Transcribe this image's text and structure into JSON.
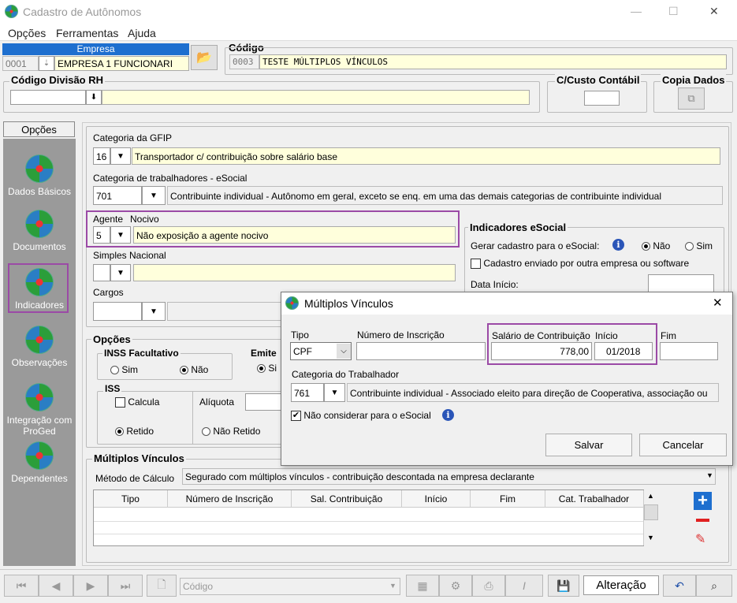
{
  "window": {
    "title": "Cadastro de Autônomos",
    "min": "—",
    "max": "☐",
    "close": "✕"
  },
  "menu": [
    "Opções",
    "Ferramentas",
    "Ajuda"
  ],
  "empresa": {
    "label": "Empresa",
    "code": "0001",
    "name": "EMPRESA 1 FUNCIONARI"
  },
  "codigo": {
    "label": "Código",
    "code": "0003",
    "name": "TESTE MÚLTIPLOS VÍNCULOS"
  },
  "divisao": {
    "label": "Código Divisão RH",
    "value": ""
  },
  "custo": {
    "label": "C/Custo Contábil"
  },
  "copia": {
    "label": "Copia Dados"
  },
  "sidebar": {
    "header": "Opções",
    "items": [
      "Dados Básicos",
      "Documentos",
      "Indicadores",
      "Observações",
      "Integração com ProGed",
      "Dependentes"
    ]
  },
  "gfip": {
    "label": "Categoria da GFIP",
    "code": "16",
    "desc": "Transportador c/ contribuição sobre salário base"
  },
  "esocial_cat": {
    "label": "Categoria de trabalhadores - eSocial",
    "code": "701",
    "desc": "Contribuinte individual - Autônomo em geral, exceto se enq. em uma das demais categorias de contribuinte individual"
  },
  "agente": {
    "label": "Agente",
    "label2": "Nocivo",
    "code": "5",
    "desc": "Não exposição a agente nocivo"
  },
  "simples": {
    "label": "Simples Nacional",
    "code": "",
    "desc": ""
  },
  "cargos": {
    "label": "Cargos"
  },
  "indicadores": {
    "title": "Indicadores eSocial",
    "gerar_label": "Gerar cadastro para o eSocial:",
    "nao": "Não",
    "sim": "Sim",
    "enviado": "Cadastro enviado por outra empresa ou software",
    "data_inicio": "Data Início:"
  },
  "opcoes": {
    "title": "Opções",
    "inss_title": "INSS Facultativo",
    "sim": "Sim",
    "nao": "Não",
    "emite": "Emite",
    "emite_sim": "Si",
    "iss_title": "ISS",
    "calcula": "Calcula",
    "aliquota": "Alíquota",
    "retido": "Retido",
    "nao_retido": "Não Retido"
  },
  "multiplos": {
    "title": "Múltiplos Vínculos",
    "metodo_label": "Método de Cálculo",
    "metodo_value": "Segurado com múltiplos vínculos - contribuição descontada na empresa declarante",
    "columns": [
      "Tipo",
      "Número de Inscrição",
      "Sal. Contribuição",
      "Início",
      "Fim",
      "Cat. Trabalhador"
    ]
  },
  "dialog": {
    "title": "Múltiplos Vínculos",
    "tipo_label": "Tipo",
    "tipo_value": "CPF",
    "num_label": "Número de Inscrição",
    "num_value": "",
    "sal_label": "Salário de Contribuição",
    "sal_value": "778,00",
    "inicio_label": "Início",
    "inicio_value": "01/2018",
    "fim_label": "Fim",
    "fim_value": "",
    "cat_label": "Categoria do Trabalhador",
    "cat_code": "761",
    "cat_desc": "Contribuinte individual - Associado eleito para direção de Cooperativa, associação ou",
    "nao_considerar": "Não considerar para o eSocial",
    "salvar": "Salvar",
    "cancelar": "Cancelar"
  },
  "bottom": {
    "search_placeholder": "Código",
    "status": "Alteração"
  },
  "colors": {
    "accent": "#1e6fcf",
    "highlight": "#9b4aa6",
    "yellow_field": "#ffffdc"
  }
}
